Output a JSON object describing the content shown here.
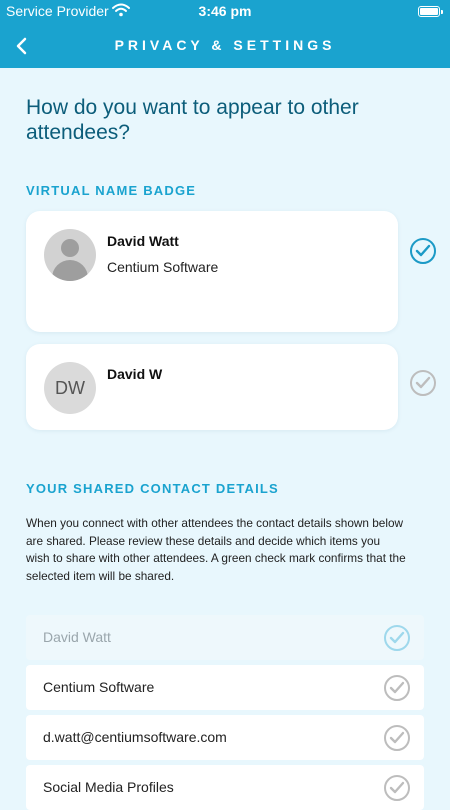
{
  "status_bar": {
    "carrier": "Service Provider",
    "time": "3:46 pm",
    "wifi_icon": "wifi-icon",
    "battery_icon": "battery-icon"
  },
  "nav": {
    "title": "PRIVACY & SETTINGS",
    "back_icon": "chevron-left-icon"
  },
  "heading": "How do you want to appear to other attendees?",
  "badge_section": {
    "label": "VIRTUAL NAME BADGE",
    "options": [
      {
        "name": "David Watt",
        "company": "Centium Software",
        "avatar": "person-silhouette",
        "selected": true
      },
      {
        "name": "David W",
        "initials": "DW",
        "selected": false
      }
    ]
  },
  "contact_section": {
    "label": "YOUR SHARED CONTACT DETAILS",
    "description": "When you connect with other attendees the contact details shown below are shared. Please review these details and decide which items you wish to share with other attendees. A green check mark confirms that the selected item will be shared.",
    "items": [
      {
        "label": "David Watt",
        "disabled": true
      },
      {
        "label": "Centium Software",
        "disabled": false
      },
      {
        "label": "d.watt@centiumsoftware.com",
        "disabled": false
      },
      {
        "label": "Social Media Profiles",
        "disabled": false
      }
    ]
  },
  "colors": {
    "accent": "#1aa3cf",
    "background": "#e8f7fd",
    "heading": "#0c5d7a",
    "check_on": "#1c9ac6",
    "check_off": "#bdbdbd"
  }
}
